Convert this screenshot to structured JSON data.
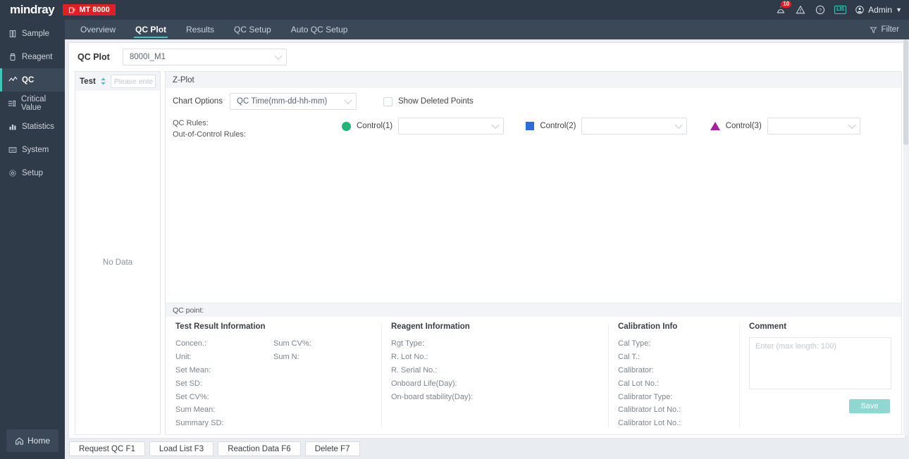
{
  "brand": {
    "logo": "mindray",
    "device": "MT 8000",
    "device_icon": "device-icon"
  },
  "topbar": {
    "alarm_icon": "alarm-icon",
    "alarm_count": "10",
    "warning_icon": "warning-icon",
    "help_icon": "help-icon",
    "lis_icon": "LIS",
    "user_icon": "user-avatar-icon",
    "user_label": "Admin"
  },
  "sidebar": {
    "items": [
      {
        "label": "Sample",
        "icon": "sample-icon"
      },
      {
        "label": "Reagent",
        "icon": "reagent-icon"
      },
      {
        "label": "QC",
        "icon": "qc-chart-icon"
      },
      {
        "label": "Critical Value",
        "icon": "critical-value-icon"
      },
      {
        "label": "Statistics",
        "icon": "statistics-icon"
      },
      {
        "label": "System",
        "icon": "system-icon"
      },
      {
        "label": "Setup",
        "icon": "setup-gear-icon"
      }
    ],
    "active_index": 2,
    "home_label": "Home",
    "home_icon": "home-icon"
  },
  "tabs": {
    "items": [
      {
        "label": "Overview"
      },
      {
        "label": "QC Plot"
      },
      {
        "label": "Results"
      },
      {
        "label": "QC Setup"
      },
      {
        "label": "Auto QC Setup"
      }
    ],
    "active_index": 1,
    "filter_label": "Filter",
    "filter_icon": "filter-icon"
  },
  "qcplot": {
    "label": "QC Plot",
    "selected": "8000I_M1"
  },
  "test_panel": {
    "header_label": "Test",
    "sort_icon": "sort-arrows-icon",
    "search_placeholder": "Please ente",
    "empty_text": "No Data"
  },
  "chart": {
    "title": "Z-Plot",
    "options_label": "Chart Options",
    "options_selected": "QC Time(mm-dd-hh-mm)",
    "show_deleted_label": "Show Deleted Points",
    "show_deleted_checked": false,
    "qc_rules_label": "QC Rules:",
    "out_of_control_label": "Out-of-Control Rules:",
    "controls": [
      {
        "name": "Control(1)",
        "marker": "circle",
        "color": "#22b573",
        "value": ""
      },
      {
        "name": "Control(2)",
        "marker": "square",
        "color": "#2d6cdf",
        "value": ""
      },
      {
        "name": "Control(3)",
        "marker": "triangle",
        "color": "#a51fa5",
        "value": ""
      }
    ]
  },
  "qc_point": {
    "header": "QC point:",
    "test_result": {
      "title": "Test Result Information",
      "left_fields": [
        "Concen.:",
        "Unit:",
        "Set Mean:",
        "Set SD:",
        "Set CV%:",
        "Sum Mean:",
        "Summary SD:"
      ],
      "right_fields": [
        "Sum CV%:",
        "Sum N:"
      ]
    },
    "reagent": {
      "title": "Reagent Information",
      "fields": [
        "Rgt Type:",
        "R. Lot No.:",
        "R. Serial No.:",
        "Onboard Life(Day):",
        "On-board stability(Day):"
      ]
    },
    "calibration": {
      "title": "Calibration Info",
      "fields": [
        "Cal Type:",
        "Cal T.:",
        "Calibrator:",
        "Cal Lot No.:",
        "Calibrator Type:",
        "Calibrator Lot No.:",
        "Calibrator Lot No.:"
      ]
    },
    "comment": {
      "title": "Comment",
      "placeholder": "Enter (max length: 100)",
      "value": "",
      "save_label": "Save"
    }
  },
  "bottom_buttons": [
    {
      "label": "Request QC F1"
    },
    {
      "label": "Load List F3"
    },
    {
      "label": "Reaction Data F6"
    },
    {
      "label": "Delete F7"
    }
  ]
}
